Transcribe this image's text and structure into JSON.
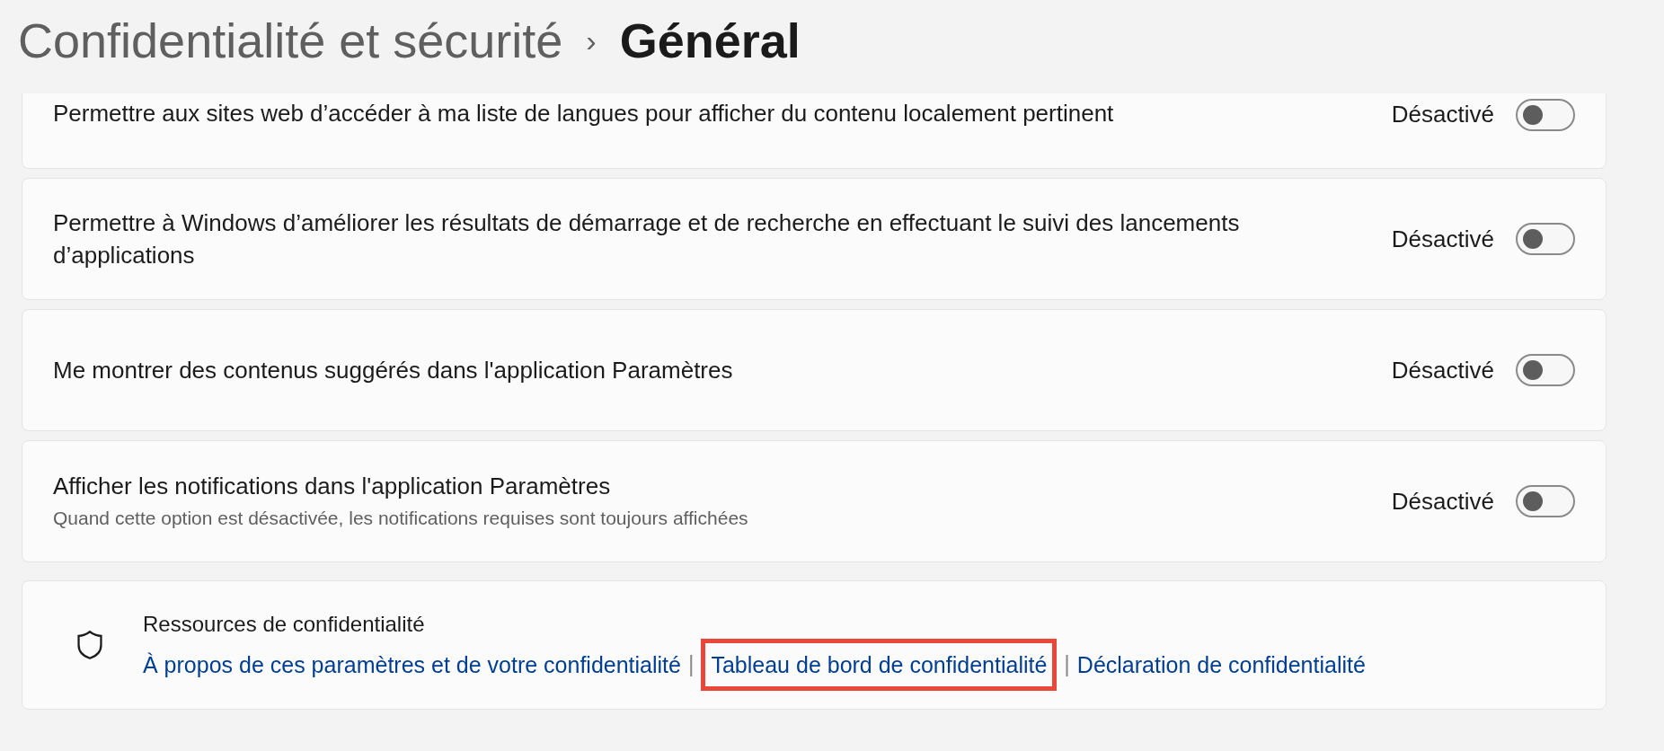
{
  "breadcrumb": {
    "parent": "Confidentialité et sécurité",
    "separator": "›",
    "current": "Général"
  },
  "settings": [
    {
      "label": "Permettre aux sites web d’accéder à ma liste de langues pour afficher du contenu localement pertinent",
      "state_label": "Désactivé",
      "on": false,
      "cut_top": true
    },
    {
      "label": "Permettre à Windows d’améliorer les résultats de démarrage et de recherche en effectuant le suivi des lancements d’applications",
      "state_label": "Désactivé",
      "on": false,
      "cut_top": false
    },
    {
      "label": "Me montrer des contenus suggérés dans l'application Paramètres",
      "state_label": "Désactivé",
      "on": false,
      "cut_top": false
    },
    {
      "label": "Afficher les notifications dans l'application Paramètres",
      "description": "Quand cette option est désactivée, les notifications requises sont toujours affichées",
      "state_label": "Désactivé",
      "on": false,
      "cut_top": false
    }
  ],
  "resources": {
    "title": "Ressources de confidentialité",
    "links": [
      {
        "kind": "link",
        "text": "À propos de ces paramètres et de votre confidentialité",
        "highlighted": false
      },
      {
        "kind": "separator",
        "text": "|"
      },
      {
        "kind": "link",
        "text": "Tableau de bord de confidentialité",
        "highlighted": true
      },
      {
        "kind": "separator",
        "text": "|"
      },
      {
        "kind": "link",
        "text": "Déclaration de confidentialité",
        "highlighted": false
      }
    ]
  }
}
